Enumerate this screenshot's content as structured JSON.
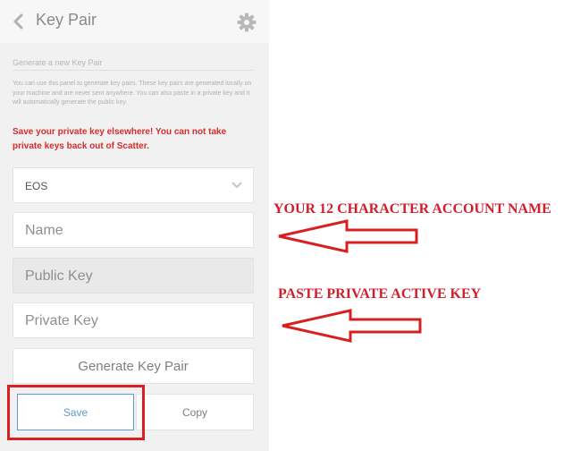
{
  "header": {
    "title": "Key Pair"
  },
  "section": {
    "title": "Generate a new Key Pair",
    "description": "You can use this panel to generate key pairs. These key pairs are generated locally on your machine and are never sent anywhere. You can also paste in a private key and it will automatically generate the public key.",
    "warning": "Save your private key elsewhere! You can not take private keys back out of Scatter."
  },
  "form": {
    "blockchain_select": "EOS",
    "name_placeholder": "Name",
    "public_key_placeholder": "Public Key",
    "private_key_placeholder": "Private Key",
    "generate_label": "Generate Key Pair",
    "save_label": "Save",
    "copy_label": "Copy"
  },
  "annotations": {
    "account_name_note": "YOUR 12 CHARACTER ACCOUNT NAME",
    "private_key_note": "PASTE PRIVATE ACTIVE KEY"
  },
  "colors": {
    "warning": "#d62c2c",
    "annotation_red": "#d72121",
    "save_blue": "#5a9bd6"
  }
}
